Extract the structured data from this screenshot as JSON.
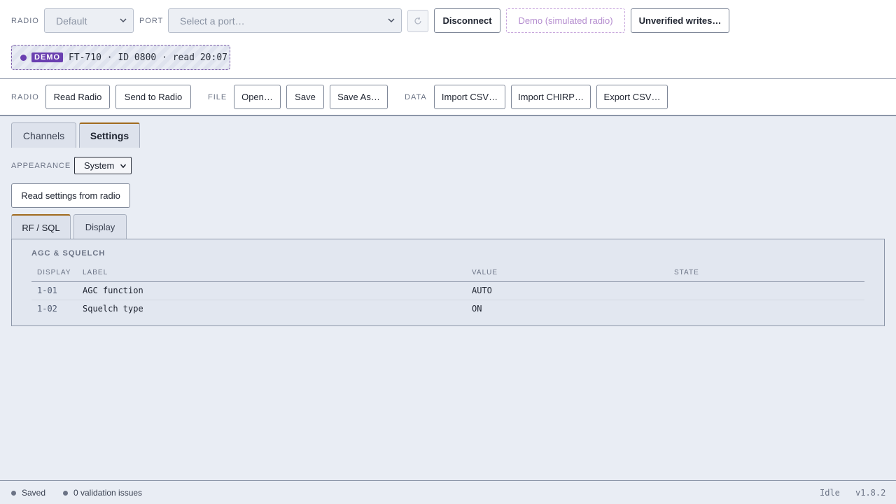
{
  "connection": {
    "radio_label": "RADIO",
    "radio_value": "Default",
    "port_label": "PORT",
    "port_placeholder": "Select a port…",
    "refresh_icon": "refresh-icon",
    "disconnect_label": "Disconnect",
    "demo_label": "Demo (simulated radio)",
    "unverified_label": "Unverified writes…"
  },
  "demo_status": {
    "badge": "DEMO",
    "text": "FT-710 · ID 0800 · read 20:07"
  },
  "toolbar": {
    "radio_group": "RADIO",
    "read_radio": "Read Radio",
    "send_to_radio": "Send to Radio",
    "file_group": "FILE",
    "open": "Open…",
    "save": "Save",
    "save_as": "Save As…",
    "data_group": "DATA",
    "import_csv": "Import CSV…",
    "import_chirp": "Import CHIRP…",
    "export_csv": "Export CSV…"
  },
  "tabs": [
    {
      "label": "Channels",
      "active": false
    },
    {
      "label": "Settings",
      "active": true
    }
  ],
  "settings": {
    "appearance_label": "APPEARANCE",
    "appearance_value": "System",
    "read_settings_button": "Read settings from radio",
    "subtabs": [
      {
        "label": "RF / SQL",
        "active": true
      },
      {
        "label": "Display",
        "active": false
      }
    ],
    "section_title": "AGC & SQUELCH",
    "columns": [
      "DISPLAY",
      "LABEL",
      "VALUE",
      "STATE"
    ],
    "rows": [
      {
        "display": "1-01",
        "label": "AGC function",
        "value": "AUTO",
        "state": ""
      },
      {
        "display": "1-02",
        "label": "Squelch type",
        "value": "ON",
        "state": ""
      }
    ]
  },
  "status_bar": {
    "saved": "Saved",
    "validation": "0 validation issues",
    "state": "Idle",
    "version": "v1.8.2"
  },
  "colors": {
    "accent_demo": "#6a3fb0",
    "active_tab_border": "#a06a1e",
    "background": "#e9edf4"
  }
}
